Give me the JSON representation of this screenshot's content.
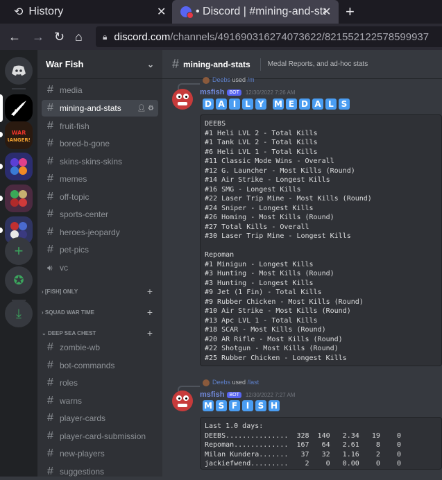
{
  "browser": {
    "tabs": [
      {
        "label": "History"
      },
      {
        "label": "• Discord | #mining-and-stats"
      }
    ],
    "url": {
      "host": "discord.com",
      "path": "/channels/491690316274073622/821552122578599937"
    }
  },
  "server": {
    "name": "War Fish",
    "channels_top": [
      {
        "name": "media"
      },
      {
        "name": "mining-and-stats"
      },
      {
        "name": "fruit-fish"
      },
      {
        "name": "bored-b-gone"
      },
      {
        "name": "skins-skins-skins"
      },
      {
        "name": "memes"
      },
      {
        "name": "off-topic"
      },
      {
        "name": "sports-center"
      },
      {
        "name": "heroes-jeopardy"
      },
      {
        "name": "pet-pics"
      },
      {
        "name": "vc"
      }
    ],
    "categories": [
      {
        "name": "[FISH] ONLY"
      },
      {
        "name": "SQUAD WAR TIME"
      },
      {
        "name": "DEEP SEA CHEST"
      }
    ],
    "channels_deep": [
      {
        "name": "zombie-wb"
      },
      {
        "name": "bot-commands"
      },
      {
        "name": "roles"
      },
      {
        "name": "warns"
      },
      {
        "name": "player-cards"
      },
      {
        "name": "player-card-submission"
      },
      {
        "name": "new-players"
      },
      {
        "name": "suggestions"
      }
    ]
  },
  "channel": {
    "name": "mining-and-stats",
    "topic": "Medal Reports, and ad-hoc stats"
  },
  "messages": [
    {
      "reply_user": "Deebs",
      "reply_used": "used",
      "reply_command": "/m",
      "author": "msfish",
      "bot_tag": "BOT",
      "time": "12/30/2022 7:26 AM",
      "banner": "DAILY MEDALS",
      "code": "DEEBS\n#1 Heli LVL 2 - Total Kills\n#1 Tank LVL 2 - Total Kills\n#6 Heli LVL 1 - Total Kills\n#11 Classic Mode Wins - Overall\n#12 G. Launcher - Most Kills (Round)\n#14 Air Strike - Longest Kills\n#16 SMG - Longest Kills\n#22 Laser Trip Mine - Most Kills (Round)\n#24 Sniper - Longest Kills\n#26 Homing - Most Kills (Round)\n#27 Total Kills - Overall\n#30 Laser Trip Mine - Longest Kills\n\nRepoman\n#1 Minigun - Longest Kills\n#3 Hunting - Most Kills (Round)\n#3 Hunting - Longest Kills\n#9 Jet (1 Fin) - Total Kills\n#9 Rubber Chicken - Most Kills (Round)\n#10 Air Strike - Most Kills (Round)\n#13 Apc LVL 1 - Total Kills\n#18 SCAR - Most Kills (Round)\n#20 AR Rifle - Most Kills (Round)\n#22 Shotgun - Most Kills (Round)\n#25 Rubber Chicken - Longest Kills"
    },
    {
      "reply_user": "Deebs",
      "reply_used": "used",
      "reply_command": "/last",
      "author": "msfish",
      "bot_tag": "BOT",
      "time": "12/30/2022 7:27 AM",
      "banner": "MSFISH",
      "code": "Last 1.0 days:\nDEEBS...............  328  140   2.34   19    0\nRepoman.............  167   64   2.61    8    0\nMilan Kundera.......   37   32   1.16    2    0\njackiefwend.........    2    0   0.00    0    0"
    }
  ],
  "colors": {
    "accent": "#5865f2",
    "banner_letter": "#4a9df2",
    "bot_avatar": "#c73b3b"
  }
}
